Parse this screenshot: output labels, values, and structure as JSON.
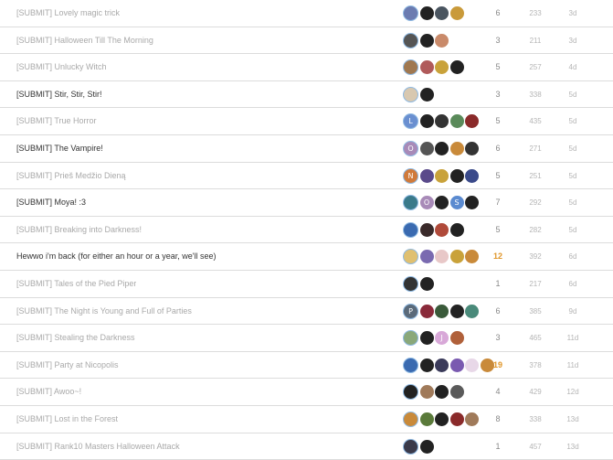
{
  "topics": [
    {
      "title": "[SUBMIT] Lovely magic trick",
      "unread": false,
      "replies": "6",
      "views": "233",
      "activity": "3d",
      "hot": false,
      "posters": [
        {
          "letter": "",
          "color": "#6b7bb0"
        },
        {
          "letter": "",
          "color": "#222222"
        },
        {
          "letter": "",
          "color": "#4a5560"
        },
        {
          "letter": "",
          "color": "#c99a3a"
        }
      ]
    },
    {
      "title": "[SUBMIT] Halloween Till The Morning",
      "unread": false,
      "replies": "3",
      "views": "211",
      "activity": "3d",
      "hot": false,
      "posters": [
        {
          "letter": "",
          "color": "#555555"
        },
        {
          "letter": "",
          "color": "#222222"
        },
        {
          "letter": "",
          "color": "#c98a6a"
        }
      ]
    },
    {
      "title": "[SUBMIT] Unlucky Witch",
      "unread": false,
      "replies": "5",
      "views": "257",
      "activity": "4d",
      "hot": false,
      "posters": [
        {
          "letter": "",
          "color": "#a07850"
        },
        {
          "letter": "",
          "color": "#b05a5a"
        },
        {
          "letter": "",
          "color": "#c9a23a"
        },
        {
          "letter": "",
          "color": "#222222"
        }
      ]
    },
    {
      "title": "[SUBMIT] Stir, Stir, Stir!",
      "unread": true,
      "replies": "3",
      "views": "338",
      "activity": "5d",
      "hot": false,
      "posters": [
        {
          "letter": "",
          "color": "#d8c8b0"
        },
        {
          "letter": "",
          "color": "#222222"
        }
      ]
    },
    {
      "title": "[SUBMIT] True Horror",
      "unread": false,
      "replies": "5",
      "views": "435",
      "activity": "5d",
      "hot": false,
      "posters": [
        {
          "letter": "L",
          "color": "#6a8fd0"
        },
        {
          "letter": "",
          "color": "#222222"
        },
        {
          "letter": "",
          "color": "#333333"
        },
        {
          "letter": "",
          "color": "#5a8a5a"
        },
        {
          "letter": "",
          "color": "#8a2a2a"
        }
      ]
    },
    {
      "title": "[SUBMIT] The Vampire!",
      "unread": true,
      "replies": "6",
      "views": "271",
      "activity": "5d",
      "hot": false,
      "posters": [
        {
          "letter": "O",
          "color": "#a88ab8"
        },
        {
          "letter": "",
          "color": "#555555"
        },
        {
          "letter": "",
          "color": "#222222"
        },
        {
          "letter": "",
          "color": "#c98a3a"
        },
        {
          "letter": "",
          "color": "#333333"
        }
      ]
    },
    {
      "title": "[SUBMIT] Prieš Medžio Dieną",
      "unread": false,
      "replies": "5",
      "views": "251",
      "activity": "5d",
      "hot": false,
      "posters": [
        {
          "letter": "N",
          "color": "#d07a3a"
        },
        {
          "letter": "",
          "color": "#5a4a8a"
        },
        {
          "letter": "",
          "color": "#c9a23a"
        },
        {
          "letter": "",
          "color": "#222222"
        },
        {
          "letter": "",
          "color": "#3a4a8a"
        }
      ]
    },
    {
      "title": "[SUBMIT] Moya! :3",
      "unread": true,
      "replies": "7",
      "views": "292",
      "activity": "5d",
      "hot": false,
      "posters": [
        {
          "letter": "",
          "color": "#3a7a8a"
        },
        {
          "letter": "O",
          "color": "#a88ab8"
        },
        {
          "letter": "",
          "color": "#222222"
        },
        {
          "letter": "S",
          "color": "#5a8ad0"
        },
        {
          "letter": "",
          "color": "#222222"
        }
      ]
    },
    {
      "title": "[SUBMIT] Breaking into Darkness!",
      "unread": false,
      "replies": "5",
      "views": "282",
      "activity": "5d",
      "hot": false,
      "posters": [
        {
          "letter": "",
          "color": "#3a6ab0"
        },
        {
          "letter": "",
          "color": "#3a2a2a"
        },
        {
          "letter": "",
          "color": "#b04a3a"
        },
        {
          "letter": "",
          "color": "#222222"
        }
      ]
    },
    {
      "title": "Hewwo i'm back (for either an hour or a year, we'll see)",
      "unread": true,
      "replies": "12",
      "views": "392",
      "activity": "6d",
      "hot": true,
      "posters": [
        {
          "letter": "",
          "color": "#e0c070"
        },
        {
          "letter": "",
          "color": "#7a6ab0"
        },
        {
          "letter": "",
          "color": "#e8c8c8"
        },
        {
          "letter": "",
          "color": "#c9a23a"
        },
        {
          "letter": "",
          "color": "#c98a3a"
        }
      ]
    },
    {
      "title": "[SUBMIT] Tales of the Pied Piper",
      "unread": false,
      "replies": "1",
      "views": "217",
      "activity": "6d",
      "hot": false,
      "posters": [
        {
          "letter": "",
          "color": "#333333"
        },
        {
          "letter": "",
          "color": "#222222"
        }
      ]
    },
    {
      "title": "[SUBMIT] The Night is Young and Full of Parties",
      "unread": false,
      "replies": "6",
      "views": "385",
      "activity": "9d",
      "hot": false,
      "posters": [
        {
          "letter": "P",
          "color": "#5a6a7a"
        },
        {
          "letter": "",
          "color": "#8a2a3a"
        },
        {
          "letter": "",
          "color": "#3a5a3a"
        },
        {
          "letter": "",
          "color": "#222222"
        },
        {
          "letter": "",
          "color": "#4a8a7a"
        }
      ]
    },
    {
      "title": "[SUBMIT] Stealing the Darkness",
      "unread": false,
      "replies": "3",
      "views": "465",
      "activity": "11d",
      "hot": false,
      "posters": [
        {
          "letter": "",
          "color": "#8aa87a"
        },
        {
          "letter": "",
          "color": "#222222"
        },
        {
          "letter": "J",
          "color": "#d8a8d8"
        },
        {
          "letter": "",
          "color": "#b0603a"
        }
      ]
    },
    {
      "title": "[SUBMIT] Party at Nicopolis",
      "unread": false,
      "replies": "19",
      "views": "378",
      "activity": "11d",
      "hot": true,
      "posters": [
        {
          "letter": "",
          "color": "#3a6ab0"
        },
        {
          "letter": "",
          "color": "#222222"
        },
        {
          "letter": "",
          "color": "#3a3a5a"
        },
        {
          "letter": "",
          "color": "#7a5ab0"
        },
        {
          "letter": "",
          "color": "#e8d8e8"
        },
        {
          "letter": "",
          "color": "#c98a3a"
        }
      ]
    },
    {
      "title": "[SUBMIT] Awoo~!",
      "unread": false,
      "replies": "4",
      "views": "429",
      "activity": "12d",
      "hot": false,
      "posters": [
        {
          "letter": "",
          "color": "#222222"
        },
        {
          "letter": "",
          "color": "#a07a5a"
        },
        {
          "letter": "",
          "color": "#222222"
        },
        {
          "letter": "",
          "color": "#5a5a5a"
        }
      ]
    },
    {
      "title": "[SUBMIT] Lost in the Forest",
      "unread": false,
      "replies": "8",
      "views": "338",
      "activity": "13d",
      "hot": false,
      "posters": [
        {
          "letter": "",
          "color": "#c98a3a"
        },
        {
          "letter": "",
          "color": "#5a7a3a"
        },
        {
          "letter": "",
          "color": "#222222"
        },
        {
          "letter": "",
          "color": "#8a2a2a"
        },
        {
          "letter": "",
          "color": "#a07a5a"
        }
      ]
    },
    {
      "title": "[SUBMIT] Rank10 Masters Halloween Attack",
      "unread": false,
      "replies": "1",
      "views": "457",
      "activity": "13d",
      "hot": false,
      "posters": [
        {
          "letter": "",
          "color": "#3a3a4a"
        },
        {
          "letter": "",
          "color": "#222222"
        }
      ]
    }
  ]
}
